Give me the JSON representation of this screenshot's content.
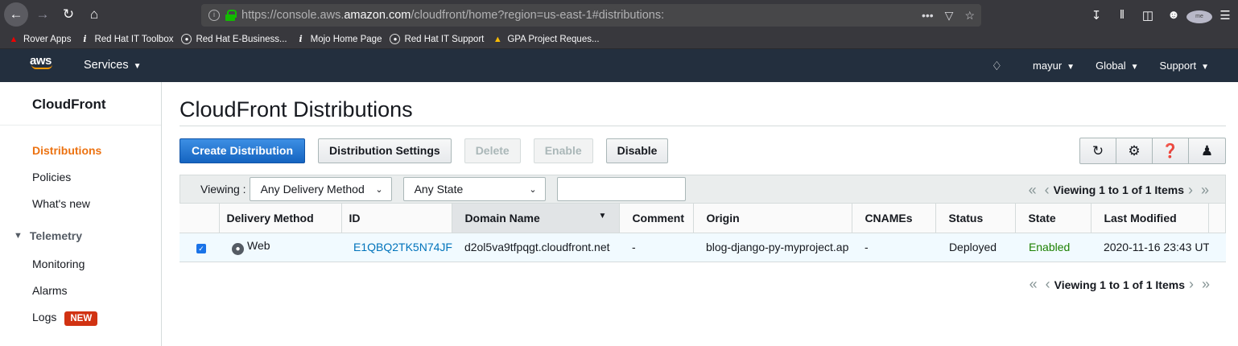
{
  "browser": {
    "url_prefix": "https://console.aws.",
    "url_domain": "amazon.com",
    "url_suffix": "/cloudfront/home?region=us-east-1#distributions:",
    "bookmarks": [
      {
        "label": "Rover Apps",
        "icon": "redhat-icon"
      },
      {
        "label": "Red Hat IT Toolbox",
        "icon": "info-icon"
      },
      {
        "label": "Red Hat E-Business...",
        "icon": "globe-icon"
      },
      {
        "label": "Mojo Home Page",
        "icon": "info-icon"
      },
      {
        "label": "Red Hat IT Support",
        "icon": "globe-icon"
      },
      {
        "label": "GPA Project Reques...",
        "icon": "drive-icon"
      }
    ],
    "profile_initials": "me"
  },
  "aws_nav": {
    "logo": "aws",
    "services": "Services",
    "user": "mayur",
    "region": "Global",
    "support": "Support"
  },
  "sidebar": {
    "title": "CloudFront",
    "items": [
      "Distributions",
      "Policies",
      "What's new"
    ],
    "telemetry_section": "Telemetry",
    "telemetry_items": [
      "Monitoring",
      "Alarms",
      "Logs"
    ],
    "new_badge": "NEW"
  },
  "page": {
    "title": "CloudFront Distributions"
  },
  "toolbar": {
    "create": "Create Distribution",
    "settings": "Distribution Settings",
    "delete": "Delete",
    "enable": "Enable",
    "disable": "Disable"
  },
  "filters": {
    "viewing_label": "Viewing :",
    "delivery_method": "Any Delivery Method",
    "state": "Any State",
    "search_value": ""
  },
  "pager": {
    "text": "Viewing 1 to 1 of 1 Items"
  },
  "table": {
    "columns": [
      "Delivery Method",
      "ID",
      "Domain Name",
      "Comment",
      "Origin",
      "CNAMEs",
      "Status",
      "State",
      "Last Modified"
    ],
    "rows": [
      {
        "selected": true,
        "delivery_method": "Web",
        "id": "E1QBQ2TK5N74JF",
        "domain_name": "d2ol5va9tfpqgt.cloudfront.net",
        "comment": "-",
        "origin": "blog-django-py-myproject.ap",
        "cnames": "-",
        "status": "Deployed",
        "state": "Enabled",
        "last_modified": "2020-11-16 23:43 UT"
      }
    ]
  },
  "colors": {
    "aws_nav_bg": "#232f3e",
    "active_item": "#ec7211",
    "primary_button": "#1564c0",
    "link": "#0073bb",
    "enabled": "#1d8102",
    "new_badge": "#d13212"
  }
}
